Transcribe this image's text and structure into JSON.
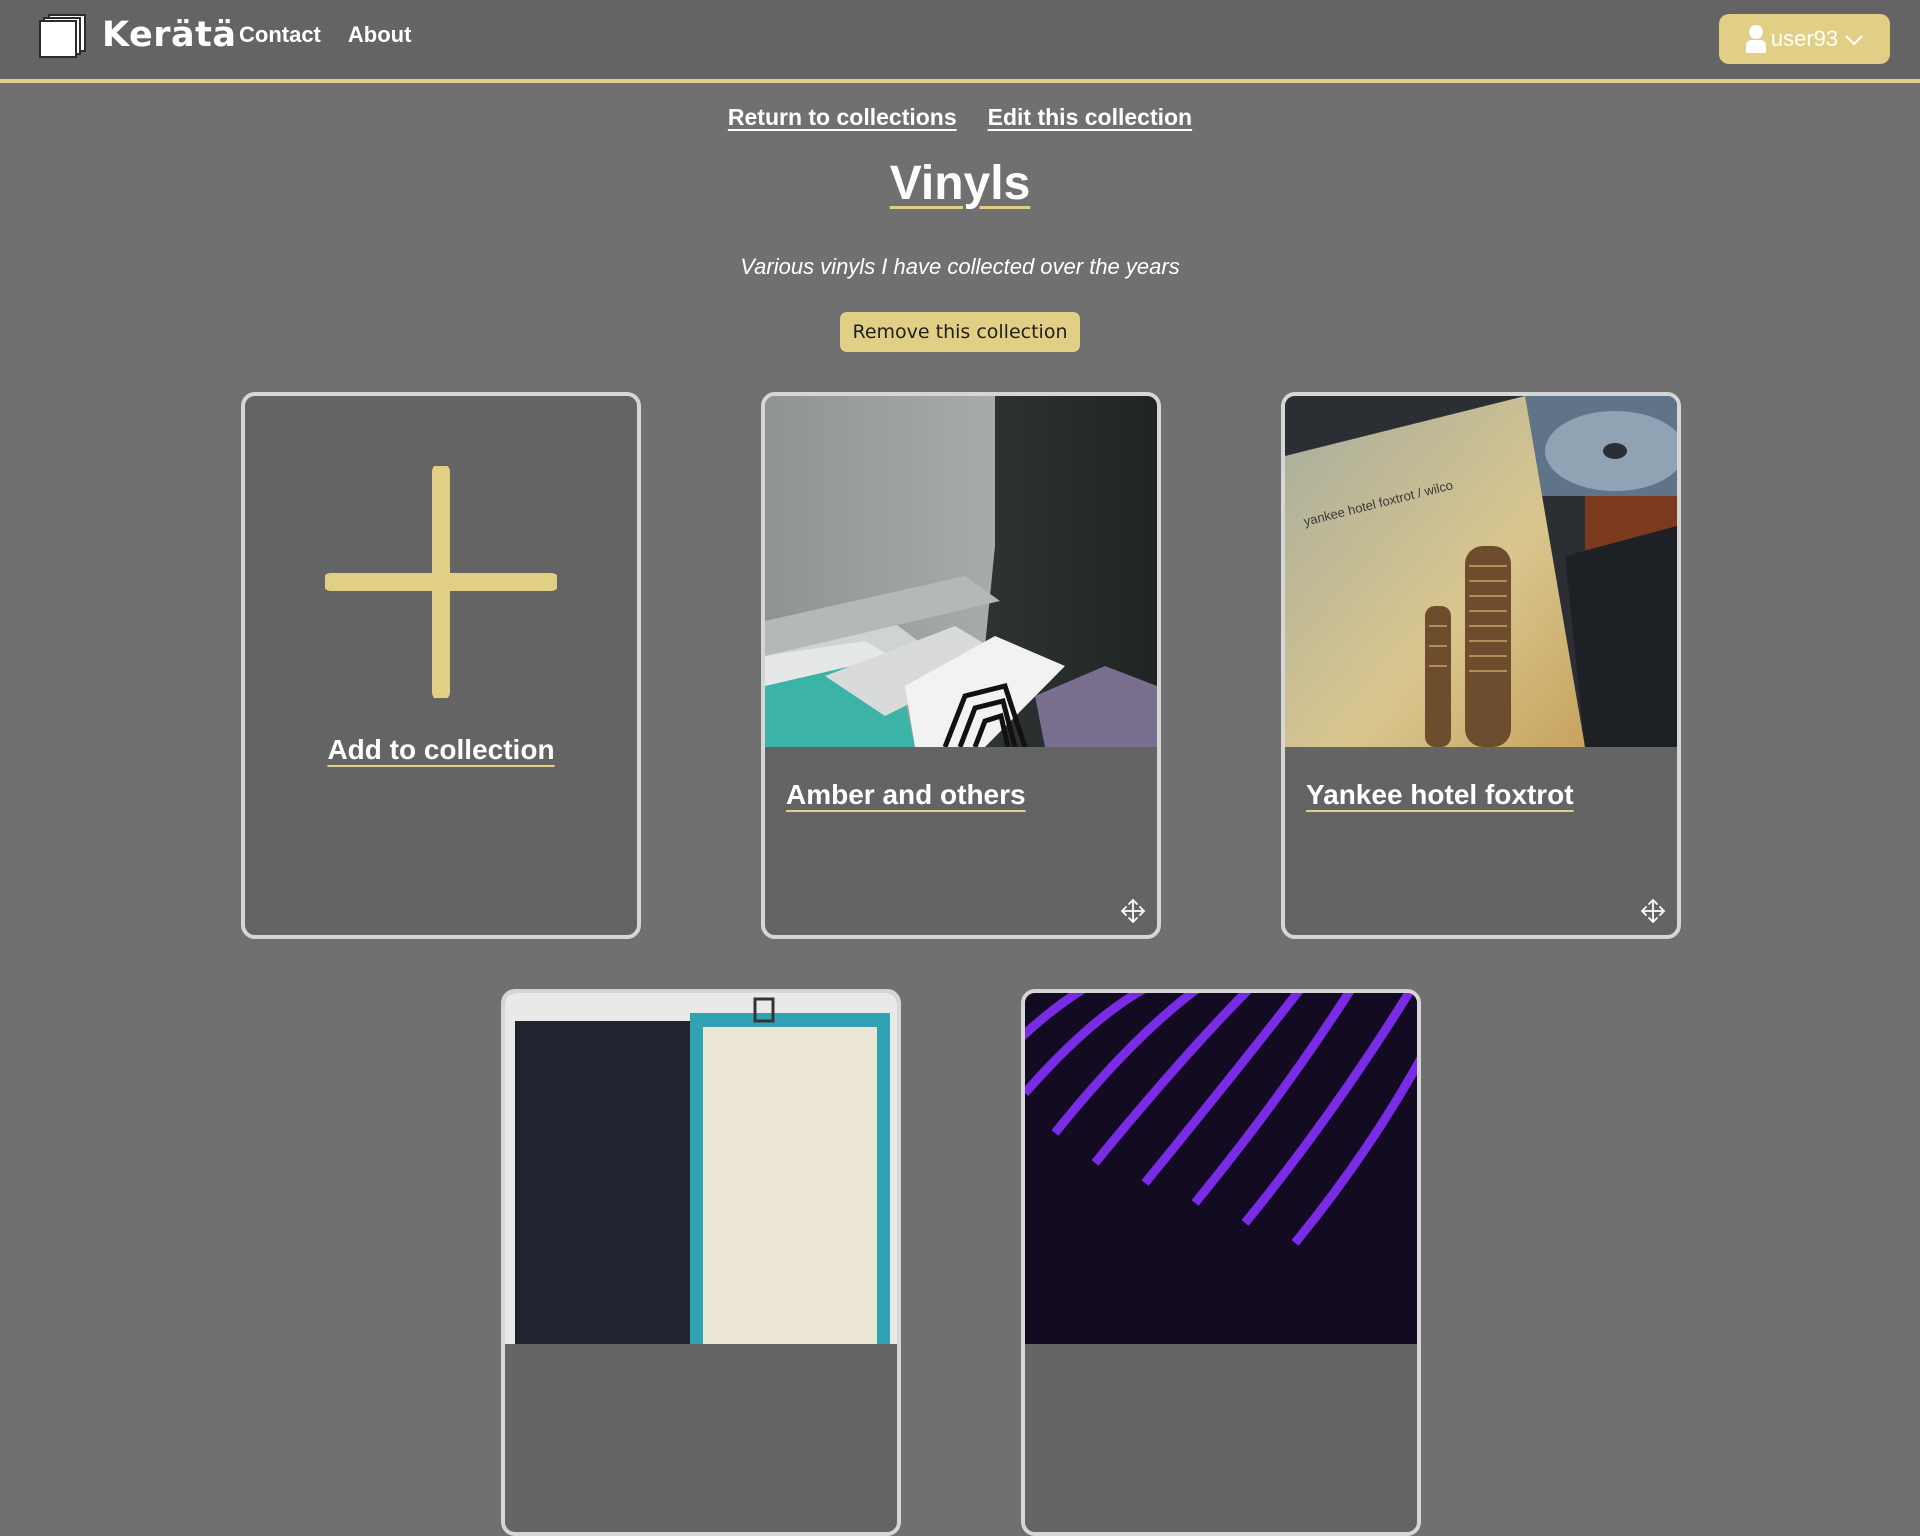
{
  "header": {
    "brand": "Kerätä",
    "nav": [
      {
        "label": "Contact"
      },
      {
        "label": "About"
      }
    ],
    "user": {
      "label": "user93"
    }
  },
  "collection": {
    "links": {
      "return": "Return to collections",
      "edit": "Edit this collection"
    },
    "title": "Vinyls",
    "description": "Various vinyls I have collected over the years",
    "remove_label": "Remove this collection"
  },
  "cards": {
    "add_label": "Add to collection",
    "items": [
      {
        "title": "Amber and others",
        "image": "vinyl-crate-photo"
      },
      {
        "title": "Yankee hotel foxtrot",
        "image": "yankee-hotel-foxtrot-record-photo",
        "cover_text": "yankee hotel foxtrot / wilco"
      },
      {
        "title": "",
        "image": "record-case-photo"
      },
      {
        "title": "",
        "image": "purple-swirl-record-photo"
      }
    ]
  },
  "colors": {
    "accent": "#e2cf86",
    "background": "#707070",
    "header_bg": "#646464",
    "card_border": "#d6d6d6"
  }
}
